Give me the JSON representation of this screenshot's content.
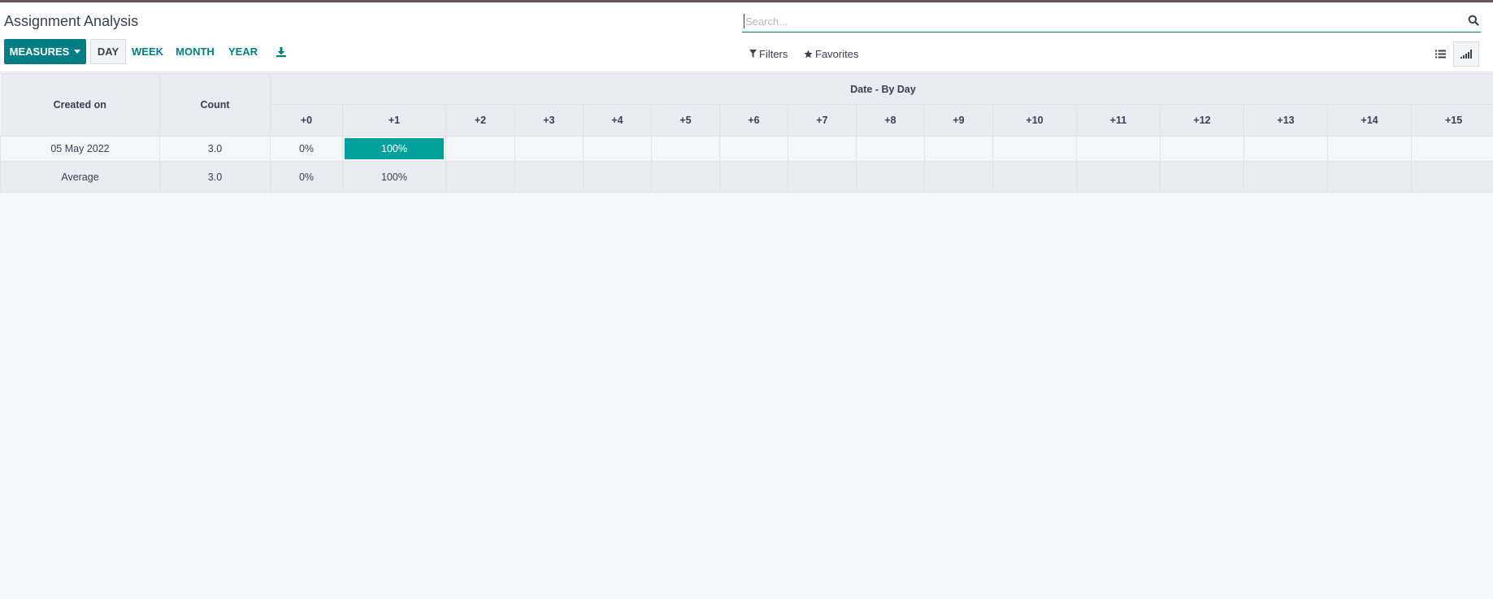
{
  "app": {
    "title": "Assignment Analysis",
    "accent_color": "#017e84",
    "top_bar_color": "#6b4f63"
  },
  "search": {
    "placeholder": "Search...",
    "value": "",
    "icon": "search-icon"
  },
  "toolbar": {
    "measures_label": "MEASURES",
    "intervals": [
      "DAY",
      "WEEK",
      "MONTH",
      "YEAR"
    ],
    "active_interval": "DAY",
    "download_icon": "download-icon",
    "filters_label": "Filters",
    "favorites_label": "Favorites",
    "views": [
      {
        "name": "list",
        "icon": "list-icon",
        "active": false
      },
      {
        "name": "cohort",
        "icon": "cohort-bars-icon",
        "active": true
      }
    ]
  },
  "table": {
    "row_header": "Created on",
    "count_header": "Count",
    "group_header": "Date - By Day",
    "periods": [
      "+0",
      "+1",
      "+2",
      "+3",
      "+4",
      "+5",
      "+6",
      "+7",
      "+8",
      "+9",
      "+10",
      "+11",
      "+12",
      "+13",
      "+14",
      "+15"
    ],
    "rows": [
      {
        "label": "05 May 2022",
        "count": "3.0",
        "cells": [
          "0%",
          "100%",
          "",
          "",
          "",
          "",
          "",
          "",
          "",
          "",
          "",
          "",
          "",
          "",
          "",
          ""
        ],
        "fill": [
          0,
          1,
          null,
          null,
          null,
          null,
          null,
          null,
          null,
          null,
          null,
          null,
          null,
          null,
          null,
          null
        ]
      }
    ],
    "average": {
      "label": "Average",
      "count": "3.0",
      "cells": [
        "0%",
        "100%",
        "",
        "",
        "",
        "",
        "",
        "",
        "",
        "",
        "",
        "",
        "",
        "",
        "",
        ""
      ]
    },
    "fill_color": "#00a09d"
  }
}
